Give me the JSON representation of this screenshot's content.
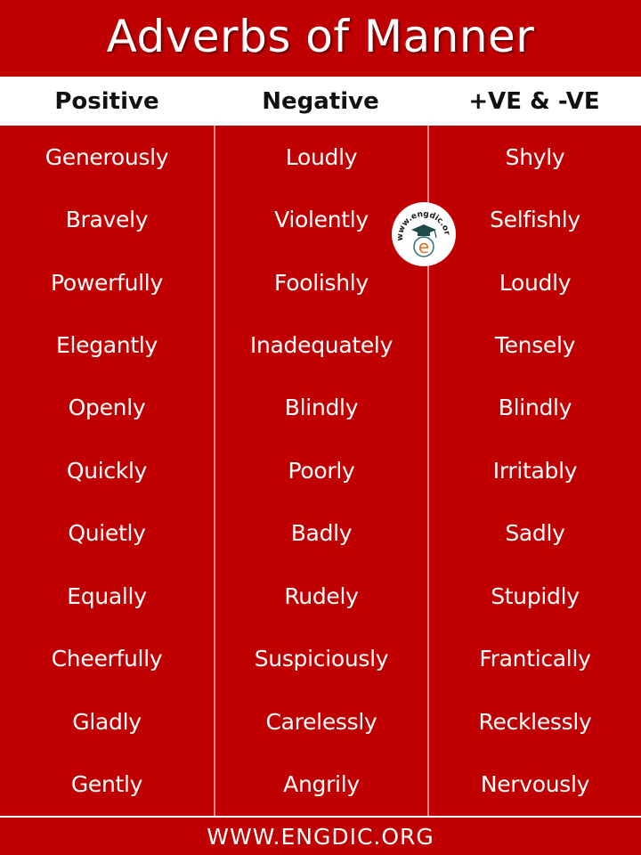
{
  "title": "Adverbs of Manner",
  "colors": {
    "primary_red": "#c00000",
    "header_background": "#ffffff",
    "text_light": "#ffffff",
    "text_dark": "#111111",
    "divider": "#e28a8a"
  },
  "columns": [
    {
      "header": "Positive",
      "words": [
        "Generously",
        "Bravely",
        "Powerfully",
        "Elegantly",
        "Openly",
        "Quickly",
        "Quietly",
        "Equally",
        "Cheerfully",
        "Gladly",
        "Gently"
      ]
    },
    {
      "header": "Negative",
      "words": [
        "Loudly",
        "Violently",
        "Foolishly",
        "Inadequately",
        "Blindly",
        "Poorly",
        "Badly",
        "Rudely",
        "Suspiciously",
        "Carelessly",
        "Angrily"
      ]
    },
    {
      "header": "+VE & -VE",
      "words": [
        "Shyly",
        "Selfishly",
        "Loudly",
        "Tensely",
        "Blindly",
        "Irritably",
        "Sadly",
        "Stupidly",
        "Frantically",
        "Recklessly",
        "Nervously"
      ]
    }
  ],
  "logo": {
    "text": "www.engdic.org",
    "letter": "e",
    "icon": "graduation-cap-icon"
  },
  "footer": "WWW.ENGDIC.ORG"
}
